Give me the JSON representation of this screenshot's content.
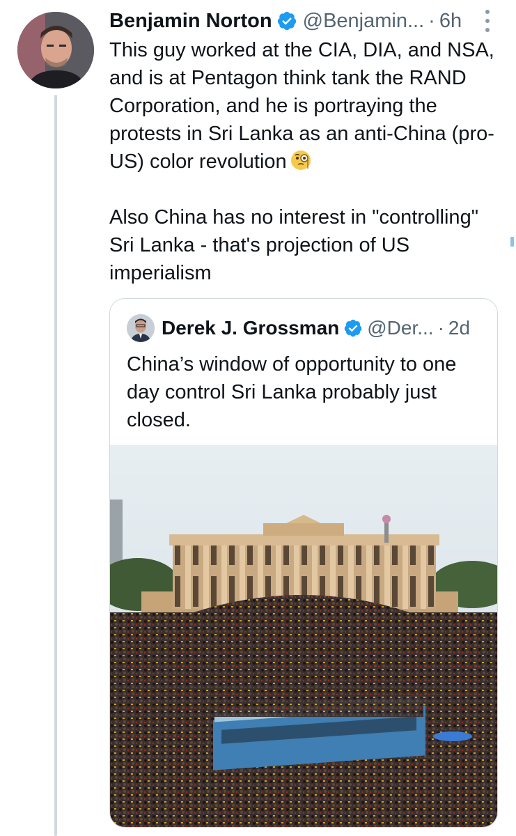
{
  "tweet": {
    "author_name": "Benjamin Norton",
    "author_handle": "@Benjamin...",
    "separator": "·",
    "time": "6h",
    "text_paragraph_1": "This guy worked at the CIA, DIA, and NSA, and is at Pentagon think tank the RAND Corporation, and he is portraying the protests in Sri Lanka as an anti-China (pro-US) color revolution",
    "text_paragraph_2": "Also China has no interest in \"controlling\" Sri Lanka - that's projection of US imperialism",
    "emoji": "face-with-monocle-icon",
    "verified": true
  },
  "quoted_tweet": {
    "author_name": "Derek J. Grossman",
    "author_handle": "@Der...",
    "separator": "·",
    "time": "2d",
    "text": "China’s window of opportunity to one day control Sri Lanka probably just closed.",
    "verified": true,
    "image": "photo-protest-crowd-colonial-building"
  },
  "colors": {
    "text": "#0f1419",
    "secondary_text": "#536471",
    "verified_blue": "#1d9bf0",
    "border": "#cfd9de"
  }
}
